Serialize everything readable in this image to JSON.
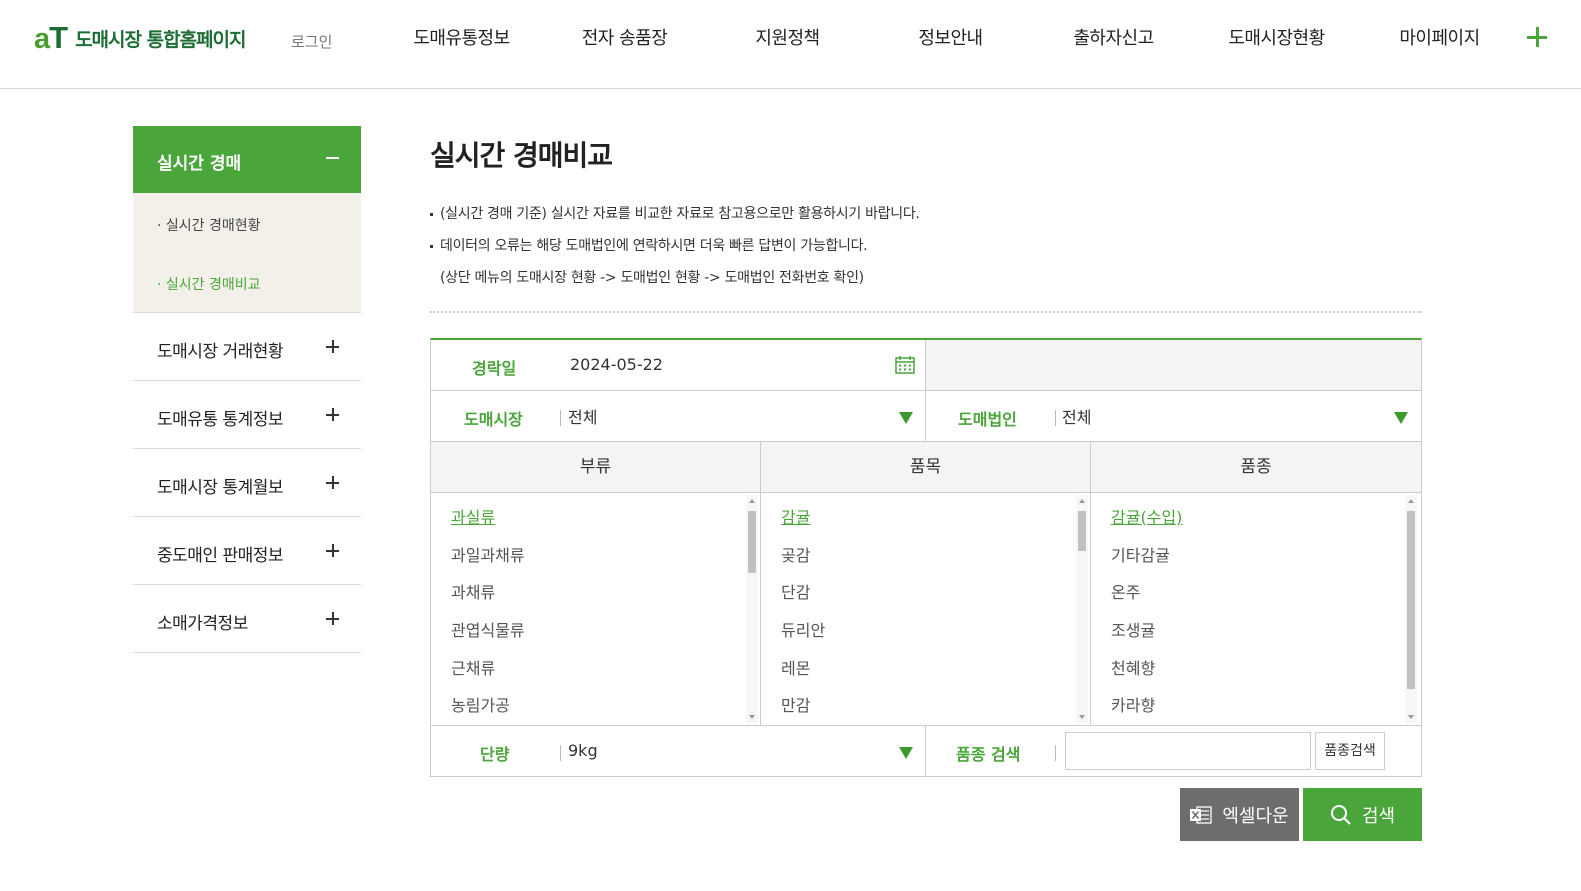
{
  "header": {
    "logo_mark_a": "a",
    "logo_mark_t": "T",
    "logo_text": "도매시장 통합홈페이지",
    "login": "로그인",
    "menu": [
      "도매유통정보",
      "전자 송품장",
      "지원정책",
      "정보안내",
      "출하자신고",
      "도매시장현황",
      "마이페이지"
    ],
    "accent_color": "#4aa63b"
  },
  "sidebar": {
    "active": "실시간 경매",
    "sub_items": [
      "실시간 경매현황",
      "실시간 경매비교"
    ],
    "items": [
      "도매시장 거래현황",
      "도매유통 통계정보",
      "도매시장 통계월보",
      "중도매인 판매정보",
      "소매가격정보"
    ]
  },
  "main": {
    "title": "실시간 경매비교",
    "notices": [
      "(실시간 경매 기준) 실시간 자료를 비교한 자료로 참고용으로만 활용하시기 바랍니다.",
      "데이터의 오류는 해당 도매법인에 연락하시면 더욱 빠른 답변이 가능합니다.",
      "(상단 메뉴의 도매시장 현황 -> 도매법인 현황 -> 도매법인 전화번호 확인)"
    ]
  },
  "form": {
    "date_label": "경락일",
    "date_value": "2024-05-22",
    "market_label": "도매시장",
    "market_value": "전체",
    "corp_label": "도매법인",
    "corp_value": "전체",
    "col_headers": [
      "부류",
      "품목",
      "품종"
    ],
    "category_list": [
      "과실류",
      "과일과채류",
      "과채류",
      "관엽식물류",
      "근채류",
      "농림가공"
    ],
    "item_list": [
      "감귤",
      "곶감",
      "단감",
      "듀리안",
      "레몬",
      "만감"
    ],
    "variety_list": [
      "감귤(수입)",
      "기타감귤",
      "온주",
      "조생귤",
      "천혜향",
      "카라향"
    ],
    "unit_label": "단량",
    "unit_value": "9kg",
    "variety_search_label": "품종 검색",
    "variety_search_value": "",
    "variety_search_button": "품종검색"
  },
  "buttons": {
    "excel": "엑셀다운",
    "search": "검색"
  }
}
